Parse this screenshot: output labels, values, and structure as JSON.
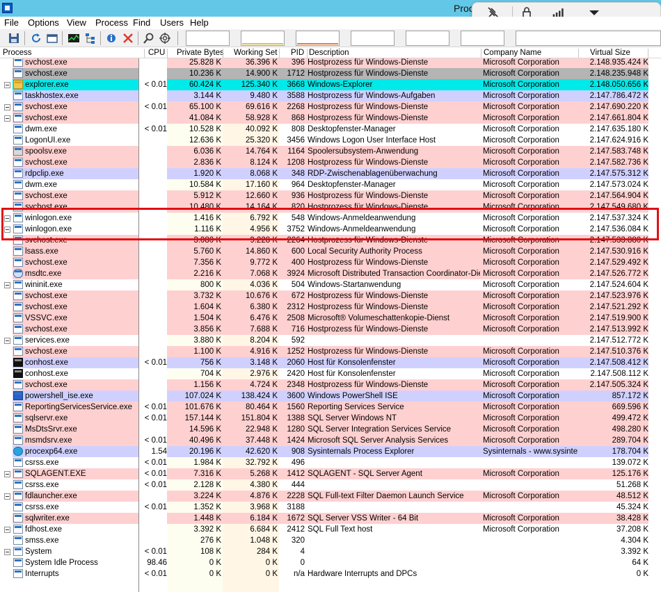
{
  "window": {
    "title": "Proc"
  },
  "overlay_icons": [
    "unpin-icon",
    "lock-icon",
    "signal-icon",
    "dropdown-arrow-icon"
  ],
  "menu": [
    "File",
    "Options",
    "View",
    "Process",
    "Find",
    "Users",
    "Help"
  ],
  "toolbar_icons": [
    "save-icon",
    "refresh-icon",
    "window-icon",
    "system-info-icon",
    "tree-icon",
    "properties-icon",
    "kill-process-icon",
    "find-icon",
    "target-icon"
  ],
  "colors": {
    "services": "#ffd0d0",
    "own": "#d0d0ff",
    "immersive": "#00eaea",
    "selected": "#b4b4b4",
    "white": "#ffffff",
    "highlight_box": "#e20e12"
  },
  "columns": {
    "process": "Process",
    "cpu": "CPU",
    "private_bytes": "Private Bytes",
    "working_set": "Working Set",
    "pid": "PID",
    "description": "Description",
    "company": "Company Name",
    "virtual_size": "Virtual Size"
  },
  "rows": [
    {
      "name": "svchost.exe",
      "cpu": "",
      "pb": "25.828 K",
      "ws": "36.396 K",
      "pid": "396",
      "desc": "Hostprozess für Windows-Dienste",
      "comp": "Microsoft Corporation",
      "vs": "2.148.935.424 K",
      "color": "services",
      "icon": "app",
      "exp": false
    },
    {
      "name": "svchost.exe",
      "cpu": "",
      "pb": "10.236 K",
      "ws": "14.900 K",
      "pid": "1712",
      "desc": "Hostprozess für Windows-Dienste",
      "comp": "Microsoft Corporation",
      "vs": "2.148.235.948 K",
      "color": "selected",
      "icon": "app",
      "exp": false
    },
    {
      "name": "explorer.exe",
      "cpu": "< 0.01",
      "pb": "60.424 K",
      "ws": "125.340 K",
      "pid": "3668",
      "desc": "Windows-Explorer",
      "comp": "Microsoft Corporation",
      "vs": "2.148.050.656 K",
      "color": "immersive",
      "icon": "explorer",
      "exp": true
    },
    {
      "name": "taskhostex.exe",
      "cpu": "",
      "pb": "3.144 K",
      "ws": "9.480 K",
      "pid": "3588",
      "desc": "Hostprozess für Windows-Aufgaben",
      "comp": "Microsoft Corporation",
      "vs": "2.147.786.472 K",
      "color": "own",
      "icon": "app",
      "exp": false
    },
    {
      "name": "svchost.exe",
      "cpu": "< 0.01",
      "pb": "65.100 K",
      "ws": "69.616 K",
      "pid": "2268",
      "desc": "Hostprozess für Windows-Dienste",
      "comp": "Microsoft Corporation",
      "vs": "2.147.690.220 K",
      "color": "services",
      "icon": "app",
      "exp": true
    },
    {
      "name": "svchost.exe",
      "cpu": "",
      "pb": "41.084 K",
      "ws": "58.928 K",
      "pid": "868",
      "desc": "Hostprozess für Windows-Dienste",
      "comp": "Microsoft Corporation",
      "vs": "2.147.661.804 K",
      "color": "services",
      "icon": "app",
      "exp": true
    },
    {
      "name": "dwm.exe",
      "cpu": "< 0.01",
      "pb": "10.528 K",
      "ws": "40.092 K",
      "pid": "808",
      "desc": "Desktopfenster-Manager",
      "comp": "Microsoft Corporation",
      "vs": "2.147.635.180 K",
      "color": "white",
      "icon": "app",
      "exp": false
    },
    {
      "name": "LogonUI.exe",
      "cpu": "",
      "pb": "12.636 K",
      "ws": "25.320 K",
      "pid": "3456",
      "desc": "Windows Logon User Interface Host",
      "comp": "Microsoft Corporation",
      "vs": "2.147.624.916 K",
      "color": "white",
      "icon": "app",
      "exp": false
    },
    {
      "name": "spoolsv.exe",
      "cpu": "",
      "pb": "6.036 K",
      "ws": "14.764 K",
      "pid": "1164",
      "desc": "Spoolersubsystem-Anwendung",
      "comp": "Microsoft Corporation",
      "vs": "2.147.583.748 K",
      "color": "services",
      "icon": "spool",
      "exp": false
    },
    {
      "name": "svchost.exe",
      "cpu": "",
      "pb": "2.836 K",
      "ws": "8.124 K",
      "pid": "1208",
      "desc": "Hostprozess für Windows-Dienste",
      "comp": "Microsoft Corporation",
      "vs": "2.147.582.736 K",
      "color": "services",
      "icon": "app",
      "exp": false
    },
    {
      "name": "rdpclip.exe",
      "cpu": "",
      "pb": "1.920 K",
      "ws": "8.068 K",
      "pid": "348",
      "desc": "RDP-Zwischenablagenüberwachung",
      "comp": "Microsoft Corporation",
      "vs": "2.147.575.312 K",
      "color": "own",
      "icon": "app",
      "exp": false
    },
    {
      "name": "dwm.exe",
      "cpu": "",
      "pb": "10.584 K",
      "ws": "17.160 K",
      "pid": "964",
      "desc": "Desktopfenster-Manager",
      "comp": "Microsoft Corporation",
      "vs": "2.147.573.024 K",
      "color": "white",
      "icon": "app",
      "exp": false
    },
    {
      "name": "svchost.exe",
      "cpu": "",
      "pb": "5.912 K",
      "ws": "12.660 K",
      "pid": "936",
      "desc": "Hostprozess für Windows-Dienste",
      "comp": "Microsoft Corporation",
      "vs": "2.147.564.904 K",
      "color": "services",
      "icon": "app",
      "exp": false
    },
    {
      "name": "svchost.exe",
      "cpu": "",
      "pb": "10.480 K",
      "ws": "14.164 K",
      "pid": "820",
      "desc": "Hostprozess für Windows-Dienste",
      "comp": "Microsoft Corporation",
      "vs": "2.147.549.680 K",
      "color": "services",
      "icon": "app",
      "exp": false
    },
    {
      "name": "winlogon.exe",
      "cpu": "",
      "pb": "1.416 K",
      "ws": "6.792 K",
      "pid": "548",
      "desc": "Windows-Anmeldeanwendung",
      "comp": "Microsoft Corporation",
      "vs": "2.147.537.324 K",
      "color": "white",
      "icon": "app",
      "exp": true
    },
    {
      "name": "winlogon.exe",
      "cpu": "",
      "pb": "1.116 K",
      "ws": "4.956 K",
      "pid": "3752",
      "desc": "Windows-Anmeldeanwendung",
      "comp": "Microsoft Corporation",
      "vs": "2.147.536.084 K",
      "color": "white",
      "icon": "app",
      "exp": true
    },
    {
      "name": "svchost.exe",
      "cpu": "",
      "pb": "3.080 K",
      "ws": "9.228 K",
      "pid": "2264",
      "desc": "Hostprozess für Windows-Dienste",
      "comp": "Microsoft Corporation",
      "vs": "2.147.533.880 K",
      "color": "services",
      "icon": "app",
      "exp": false
    },
    {
      "name": "lsass.exe",
      "cpu": "",
      "pb": "5.760 K",
      "ws": "14.860 K",
      "pid": "600",
      "desc": "Local Security Authority Process",
      "comp": "Microsoft Corporation",
      "vs": "2.147.530.916 K",
      "color": "services",
      "icon": "app",
      "exp": false
    },
    {
      "name": "svchost.exe",
      "cpu": "",
      "pb": "7.356 K",
      "ws": "9.772 K",
      "pid": "400",
      "desc": "Hostprozess für Windows-Dienste",
      "comp": "Microsoft Corporation",
      "vs": "2.147.529.492 K",
      "color": "services",
      "icon": "app",
      "exp": false
    },
    {
      "name": "msdtc.exe",
      "cpu": "",
      "pb": "2.216 K",
      "ws": "7.068 K",
      "pid": "3924",
      "desc": "Microsoft Distributed Transaction Coordinator-Dienst",
      "comp": "Microsoft Corporation",
      "vs": "2.147.526.772 K",
      "color": "services",
      "icon": "msdtc",
      "exp": false
    },
    {
      "name": "wininit.exe",
      "cpu": "",
      "pb": "800 K",
      "ws": "4.036 K",
      "pid": "504",
      "desc": "Windows-Startanwendung",
      "comp": "Microsoft Corporation",
      "vs": "2.147.524.604 K",
      "color": "white",
      "icon": "app",
      "exp": true
    },
    {
      "name": "svchost.exe",
      "cpu": "",
      "pb": "3.732 K",
      "ws": "10.676 K",
      "pid": "672",
      "desc": "Hostprozess für Windows-Dienste",
      "comp": "Microsoft Corporation",
      "vs": "2.147.523.976 K",
      "color": "services",
      "icon": "app",
      "exp": false
    },
    {
      "name": "svchost.exe",
      "cpu": "",
      "pb": "1.604 K",
      "ws": "6.380 K",
      "pid": "2312",
      "desc": "Hostprozess für Windows-Dienste",
      "comp": "Microsoft Corporation",
      "vs": "2.147.521.292 K",
      "color": "services",
      "icon": "app",
      "exp": false
    },
    {
      "name": "VSSVC.exe",
      "cpu": "",
      "pb": "1.504 K",
      "ws": "6.476 K",
      "pid": "2508",
      "desc": "Microsoft® Volumeschattenkopie-Dienst",
      "comp": "Microsoft Corporation",
      "vs": "2.147.519.900 K",
      "color": "services",
      "icon": "app",
      "exp": false
    },
    {
      "name": "svchost.exe",
      "cpu": "",
      "pb": "3.856 K",
      "ws": "7.688 K",
      "pid": "716",
      "desc": "Hostprozess für Windows-Dienste",
      "comp": "Microsoft Corporation",
      "vs": "2.147.513.992 K",
      "color": "services",
      "icon": "app",
      "exp": false
    },
    {
      "name": "services.exe",
      "cpu": "",
      "pb": "3.880 K",
      "ws": "8.204 K",
      "pid": "592",
      "desc": "",
      "comp": "",
      "vs": "2.147.512.772 K",
      "color": "white",
      "icon": "app",
      "exp": true
    },
    {
      "name": "svchost.exe",
      "cpu": "",
      "pb": "1.100 K",
      "ws": "4.916 K",
      "pid": "1252",
      "desc": "Hostprozess für Windows-Dienste",
      "comp": "Microsoft Corporation",
      "vs": "2.147.510.376 K",
      "color": "services",
      "icon": "app",
      "exp": false
    },
    {
      "name": "conhost.exe",
      "cpu": "< 0.01",
      "pb": "756 K",
      "ws": "3.148 K",
      "pid": "2060",
      "desc": "Host für Konsolenfenster",
      "comp": "Microsoft Corporation",
      "vs": "2.147.508.412 K",
      "color": "own",
      "icon": "console",
      "exp": false
    },
    {
      "name": "conhost.exe",
      "cpu": "",
      "pb": "704 K",
      "ws": "2.976 K",
      "pid": "2420",
      "desc": "Host für Konsolenfenster",
      "comp": "Microsoft Corporation",
      "vs": "2.147.508.112 K",
      "color": "white",
      "icon": "console",
      "exp": false
    },
    {
      "name": "svchost.exe",
      "cpu": "",
      "pb": "1.156 K",
      "ws": "4.724 K",
      "pid": "2348",
      "desc": "Hostprozess für Windows-Dienste",
      "comp": "Microsoft Corporation",
      "vs": "2.147.505.324 K",
      "color": "services",
      "icon": "app",
      "exp": false
    },
    {
      "name": "powershell_ise.exe",
      "cpu": "",
      "pb": "107.024 K",
      "ws": "138.424 K",
      "pid": "3600",
      "desc": "Windows PowerShell ISE",
      "comp": "Microsoft Corporation",
      "vs": "857.172 K",
      "color": "own",
      "icon": "ps",
      "exp": false
    },
    {
      "name": "ReportingServicesService.exe",
      "cpu": "< 0.01",
      "pb": "101.676 K",
      "ws": "80.464 K",
      "pid": "1560",
      "desc": "Reporting Services Service",
      "comp": "Microsoft Corporation",
      "vs": "669.596 K",
      "color": "services",
      "icon": "app",
      "exp": false
    },
    {
      "name": "sqlservr.exe",
      "cpu": "< 0.01",
      "pb": "157.144 K",
      "ws": "151.804 K",
      "pid": "1388",
      "desc": "SQL Server Windows NT",
      "comp": "Microsoft Corporation",
      "vs": "499.472 K",
      "color": "services",
      "icon": "app",
      "exp": false
    },
    {
      "name": "MsDtsSrvr.exe",
      "cpu": "",
      "pb": "14.596 K",
      "ws": "22.948 K",
      "pid": "1280",
      "desc": "SQL Server Integration Services Service",
      "comp": "Microsoft Corporation",
      "vs": "498.280 K",
      "color": "services",
      "icon": "app",
      "exp": false
    },
    {
      "name": "msmdsrv.exe",
      "cpu": "< 0.01",
      "pb": "40.496 K",
      "ws": "37.448 K",
      "pid": "1424",
      "desc": "Microsoft SQL Server Analysis Services",
      "comp": "Microsoft Corporation",
      "vs": "289.704 K",
      "color": "services",
      "icon": "app",
      "exp": false
    },
    {
      "name": "procexp64.exe",
      "cpu": "1.54",
      "pb": "20.196 K",
      "ws": "42.620 K",
      "pid": "908",
      "desc": "Sysinternals Process Explorer",
      "comp": "Sysinternals - www.sysinter...",
      "vs": "178.704 K",
      "color": "own",
      "icon": "procexp",
      "exp": false
    },
    {
      "name": "csrss.exe",
      "cpu": "< 0.01",
      "pb": "1.984 K",
      "ws": "32.792 K",
      "pid": "496",
      "desc": "",
      "comp": "",
      "vs": "139.072 K",
      "color": "white",
      "icon": "app",
      "exp": false
    },
    {
      "name": "SQLAGENT.EXE",
      "cpu": "< 0.01",
      "pb": "7.316 K",
      "ws": "5.268 K",
      "pid": "1412",
      "desc": "SQLAGENT - SQL Server Agent",
      "comp": "Microsoft Corporation",
      "vs": "125.176 K",
      "color": "services",
      "icon": "app",
      "exp": true
    },
    {
      "name": "csrss.exe",
      "cpu": "< 0.01",
      "pb": "2.128 K",
      "ws": "4.380 K",
      "pid": "444",
      "desc": "",
      "comp": "",
      "vs": "51.268 K",
      "color": "white",
      "icon": "app",
      "exp": false
    },
    {
      "name": "fdlauncher.exe",
      "cpu": "",
      "pb": "3.224 K",
      "ws": "4.876 K",
      "pid": "2228",
      "desc": "SQL Full-text Filter Daemon Launch Service",
      "comp": "Microsoft Corporation",
      "vs": "48.512 K",
      "color": "services",
      "icon": "app",
      "exp": true
    },
    {
      "name": "csrss.exe",
      "cpu": "< 0.01",
      "pb": "1.352 K",
      "ws": "3.968 K",
      "pid": "3188",
      "desc": "",
      "comp": "",
      "vs": "45.324 K",
      "color": "white",
      "icon": "app",
      "exp": false
    },
    {
      "name": "sqlwriter.exe",
      "cpu": "",
      "pb": "1.448 K",
      "ws": "6.184 K",
      "pid": "1672",
      "desc": "SQL Server VSS Writer - 64 Bit",
      "comp": "Microsoft Corporation",
      "vs": "38.428 K",
      "color": "services",
      "icon": "app",
      "exp": false
    },
    {
      "name": "fdhost.exe",
      "cpu": "",
      "pb": "3.392 K",
      "ws": "6.684 K",
      "pid": "2412",
      "desc": "SQL Full Text host",
      "comp": "Microsoft Corporation",
      "vs": "37.208 K",
      "color": "white",
      "icon": "app",
      "exp": true
    },
    {
      "name": "smss.exe",
      "cpu": "",
      "pb": "276 K",
      "ws": "1.048 K",
      "pid": "320",
      "desc": "",
      "comp": "",
      "vs": "4.304 K",
      "color": "white",
      "icon": "app",
      "exp": false
    },
    {
      "name": "System",
      "cpu": "< 0.01",
      "pb": "108 K",
      "ws": "284 K",
      "pid": "4",
      "desc": "",
      "comp": "",
      "vs": "3.392 K",
      "color": "white",
      "icon": "app",
      "exp": true
    },
    {
      "name": "System Idle Process",
      "cpu": "98.46",
      "pb": "0 K",
      "ws": "0 K",
      "pid": "0",
      "desc": "",
      "comp": "",
      "vs": "64 K",
      "color": "white",
      "icon": "app",
      "exp": false
    },
    {
      "name": "Interrupts",
      "cpu": "< 0.01",
      "pb": "0 K",
      "ws": "0 K",
      "pid": "n/a",
      "desc": "Hardware Interrupts and DPCs",
      "comp": "",
      "vs": "0 K",
      "color": "white",
      "icon": "app",
      "exp": false
    }
  ]
}
